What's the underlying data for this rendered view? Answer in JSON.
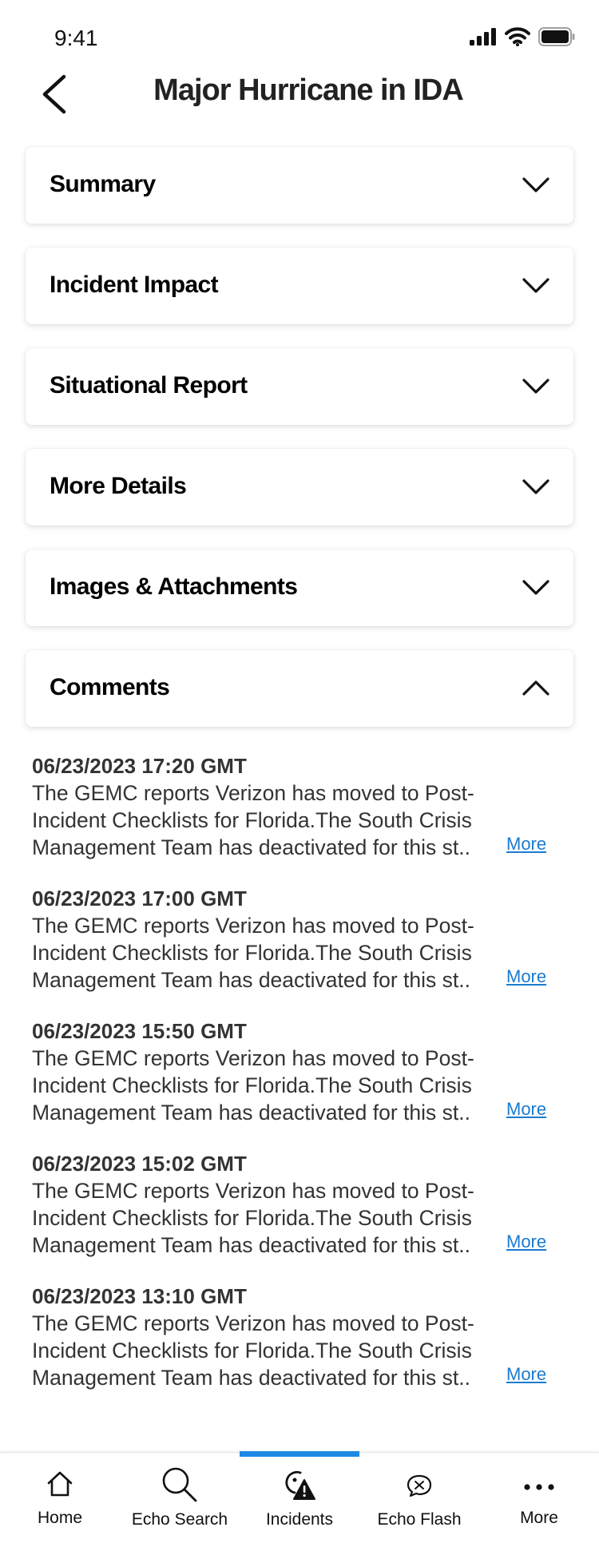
{
  "status_bar": {
    "time": "9:41",
    "icons": [
      "signal-icon",
      "wifi-icon",
      "battery-icon"
    ]
  },
  "header": {
    "title": "Major Hurricane in IDA",
    "back_icon": "chevron-left-icon"
  },
  "sections": [
    {
      "label": "Summary",
      "state": "collapsed"
    },
    {
      "label": "Incident Impact",
      "state": "collapsed"
    },
    {
      "label": "Situational Report",
      "state": "collapsed"
    },
    {
      "label": "More Details",
      "state": "collapsed"
    },
    {
      "label": "Images & Attachments",
      "state": "collapsed"
    },
    {
      "label": "Comments",
      "state": "expanded"
    }
  ],
  "comments": [
    {
      "time": "06/23/2023 17:20 GMT",
      "text": "The GEMC reports Verizon has moved to Post-Incident Checklists for Florida.The South Crisis Management Team has deactivated for this st..",
      "more": "More"
    },
    {
      "time": "06/23/2023 17:00 GMT",
      "text": "The GEMC reports Verizon has moved to Post-Incident Checklists for Florida.The South Crisis Management Team has deactivated for this st..",
      "more": "More"
    },
    {
      "time": "06/23/2023 15:50 GMT",
      "text": "The GEMC reports Verizon has moved to Post-Incident Checklists for Florida.The South Crisis Management Team has deactivated for this st..",
      "more": "More"
    },
    {
      "time": "06/23/2023 15:02 GMT",
      "text": "The GEMC reports Verizon has moved to Post-Incident Checklists for Florida.The South Crisis Management Team has deactivated for this st..",
      "more": "More"
    },
    {
      "time": "06/23/2023 13:10 GMT",
      "text": "The GEMC reports Verizon has moved to Post-Incident Checklists for Florida.The South Crisis Management Team has deactivated for this st..",
      "more": "More"
    }
  ],
  "bottom_nav": {
    "active": "Incidents",
    "accent_color": "#1e88e5",
    "items": [
      {
        "label": "Home",
        "icon": "home-icon"
      },
      {
        "label": "Echo Search",
        "icon": "search-icon"
      },
      {
        "label": "Incidents",
        "icon": "incidents-icon"
      },
      {
        "label": "Echo Flash",
        "icon": "echo-flash-icon"
      },
      {
        "label": "More",
        "icon": "more-dots-icon"
      }
    ]
  },
  "colors": {
    "link": "#1a7bd0",
    "text": "#333333",
    "background": "#ffffff"
  }
}
